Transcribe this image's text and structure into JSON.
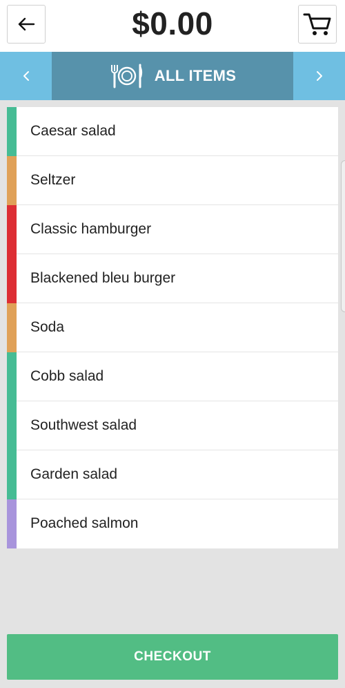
{
  "header": {
    "total": "$0.00",
    "back_icon": "arrow-left-icon",
    "cart_icon": "shopping-cart-icon"
  },
  "category_bar": {
    "label": "ALL ITEMS",
    "icon": "fork-plate-knife-icon",
    "prev_icon": "chevron-left-icon",
    "next_icon": "chevron-right-icon",
    "bar_color": "#6fbfe2",
    "center_color": "#5792ab"
  },
  "items": [
    {
      "label": "Caesar salad",
      "color": "#46bc94"
    },
    {
      "label": "Seltzer",
      "color": "#e0a158"
    },
    {
      "label": "Classic hamburger",
      "color": "#dd2e34"
    },
    {
      "label": "Blackened bleu burger",
      "color": "#dd2e34"
    },
    {
      "label": "Soda",
      "color": "#e0a158"
    },
    {
      "label": "Cobb salad",
      "color": "#46bc94"
    },
    {
      "label": "Southwest salad",
      "color": "#46bc94"
    },
    {
      "label": "Garden salad",
      "color": "#46bc94"
    },
    {
      "label": "Poached salmon",
      "color": "#a894dc"
    }
  ],
  "checkout": {
    "label": "CHECKOUT",
    "color": "#52bd84"
  }
}
